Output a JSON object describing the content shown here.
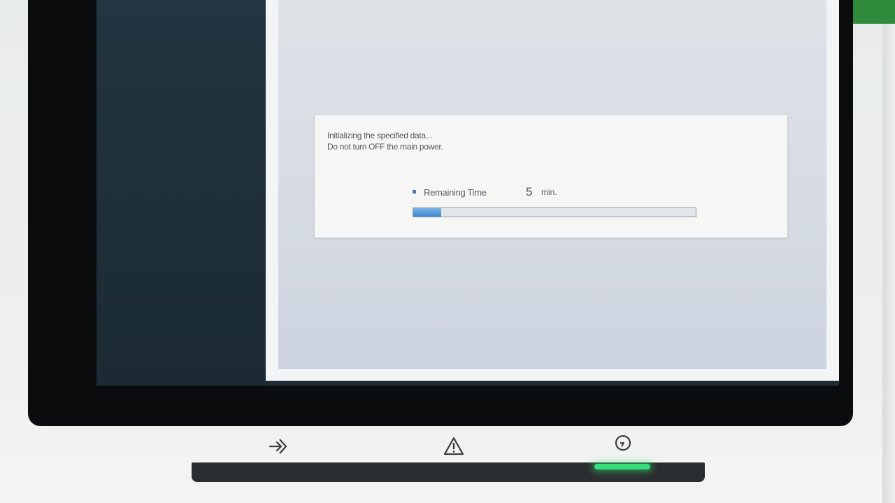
{
  "dialog": {
    "message_line1": "Initializing the specified data...",
    "message_line2": "Do not turn OFF the main power.",
    "remaining_label": "Remaining Time",
    "remaining_value": "5",
    "remaining_unit": "min.",
    "progress_fraction": 0.1
  },
  "hardware_keys": {
    "login_icon": "login-arrow-icon",
    "alert_icon": "warning-triangle-icon",
    "power_icon": "power-icon"
  },
  "colors": {
    "progress_fill": "#3b87cf",
    "status_led": "#35e07a"
  }
}
